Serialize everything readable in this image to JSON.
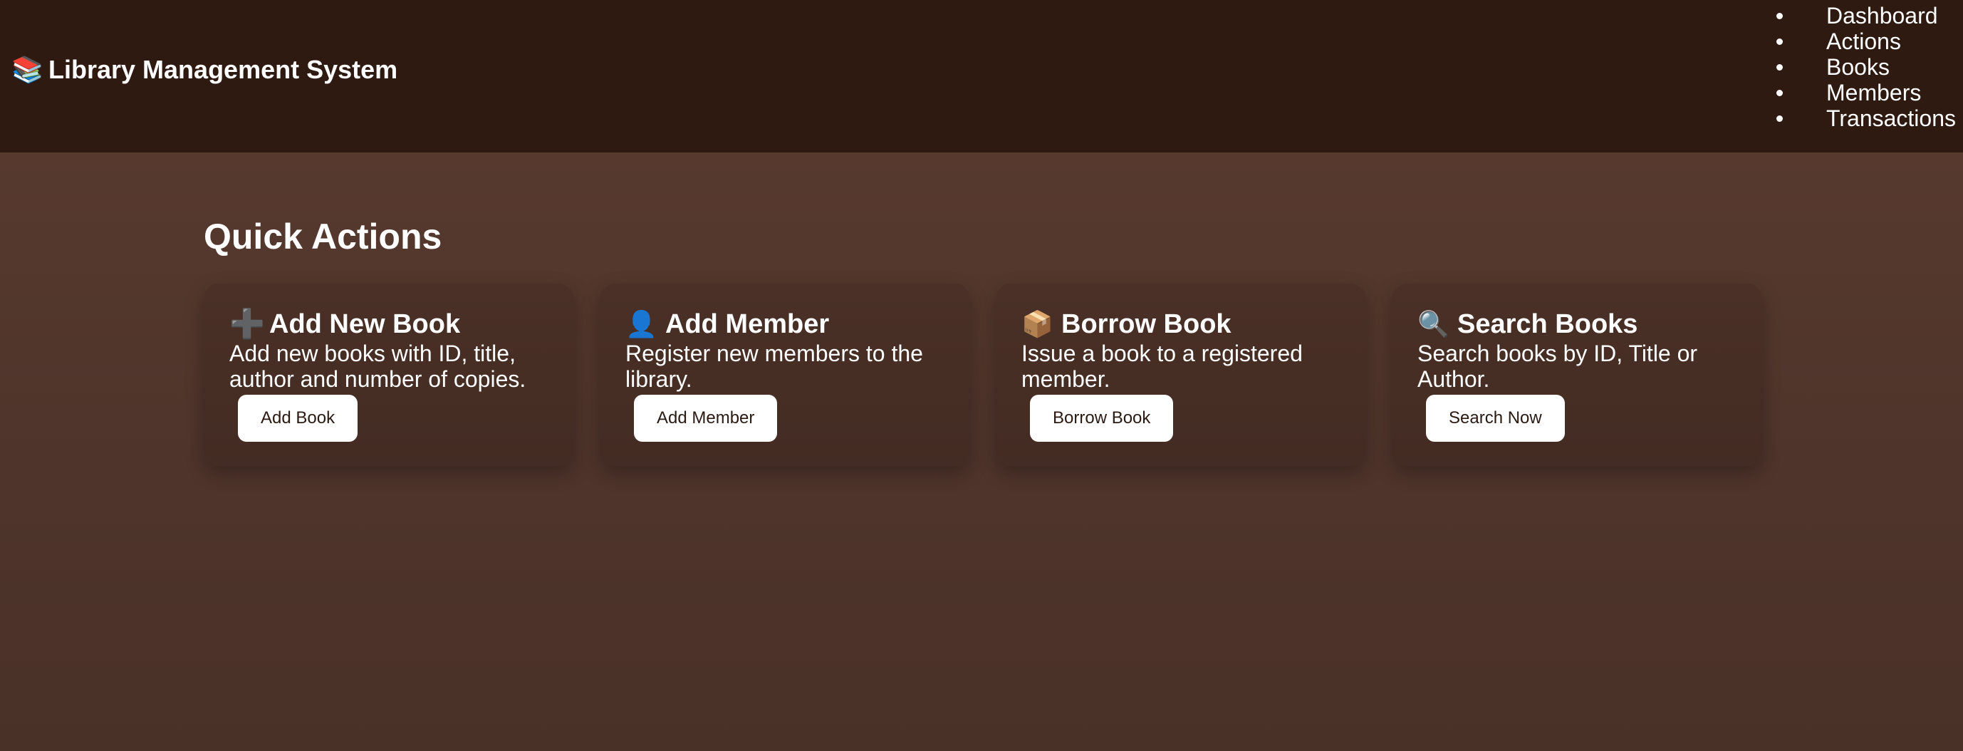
{
  "header": {
    "icon": "books-icon",
    "title": "Library Management System"
  },
  "nav": {
    "items": [
      "Dashboard",
      "Actions",
      "Books",
      "Members",
      "Transactions"
    ]
  },
  "main": {
    "section_title": "Quick Actions",
    "cards": [
      {
        "icon": "plus-icon",
        "title": "Add New Book",
        "description": "Add new books with ID, title, author and number of copies.",
        "button": "Add Book"
      },
      {
        "icon": "person-icon",
        "title": "Add Member",
        "description": "Register new members to the library.",
        "button": "Add Member"
      },
      {
        "icon": "package-icon",
        "title": "Borrow Book",
        "description": "Issue a book to a registered member.",
        "button": "Borrow Book"
      },
      {
        "icon": "search-icon",
        "title": "Search Books",
        "description": "Search books by ID, Title or Author.",
        "button": "Search Now"
      }
    ]
  },
  "colors": {
    "header_bg": "#2e1a11",
    "page_bg": "#5c3c30",
    "card_bg": "#4a3026",
    "button_bg": "#ffffff",
    "text": "#ffffff"
  }
}
